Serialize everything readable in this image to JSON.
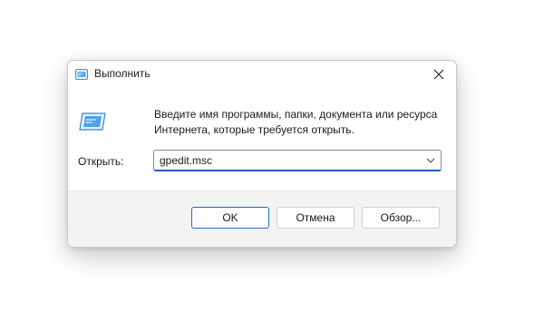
{
  "window": {
    "title": "Выполнить",
    "close_icon": "close-icon",
    "app_icon": "run-icon"
  },
  "body": {
    "description_line1": "Введите имя программы, папки, документа или ресурса",
    "description_line2": "Интернета, которые требуется открыть.",
    "open_label": "Открыть:",
    "open_value": "gpedit.msc"
  },
  "buttons": {
    "ok": "OK",
    "cancel": "Отмена",
    "browse": "Обзор..."
  },
  "colors": {
    "accent": "#1f5fbf",
    "icon_blue": "#3a8fd8"
  }
}
